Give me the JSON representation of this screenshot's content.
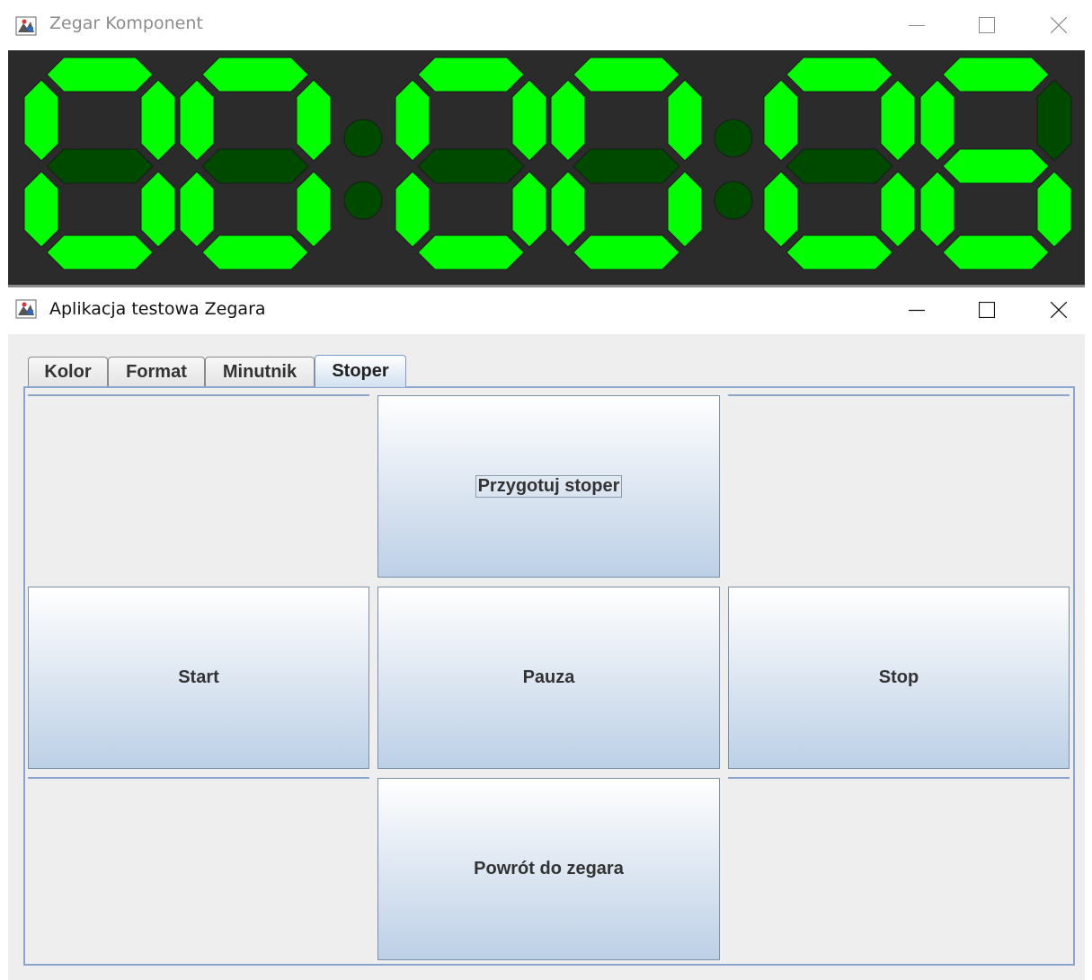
{
  "clock_window": {
    "title": "Zegar Komponent",
    "icons": [
      "java-app-icon",
      "minimize-icon",
      "maximize-icon",
      "close-icon"
    ],
    "display": {
      "background_color": "#2b2b2b",
      "segment_on_color": "#00ff00",
      "segment_off_color": "#004a00",
      "digits": [
        {
          "on": [
            "a",
            "b",
            "c",
            "d",
            "e",
            "f"
          ]
        },
        {
          "on": [
            "a",
            "b",
            "c",
            "d",
            "e",
            "f"
          ]
        },
        {
          "on": [
            "a",
            "b",
            "c",
            "d",
            "e",
            "f"
          ]
        },
        {
          "on": [
            "a",
            "b",
            "c",
            "d",
            "e",
            "f"
          ]
        },
        {
          "on": [
            "a",
            "b",
            "c",
            "d",
            "e",
            "f"
          ]
        },
        {
          "on": [
            "a",
            "c",
            "d",
            "e",
            "f",
            "g"
          ]
        }
      ],
      "colons_lit": false
    }
  },
  "test_window": {
    "title": "Aplikacja testowa Zegara",
    "tabs": [
      {
        "label": "Kolor",
        "selected": false
      },
      {
        "label": "Format",
        "selected": false
      },
      {
        "label": "Minutnik",
        "selected": false
      },
      {
        "label": "Stoper",
        "selected": true
      }
    ],
    "buttons": {
      "prepare": "Przygotuj stoper",
      "start": "Start",
      "pause": "Pauza",
      "stop": "Stop",
      "back": "Powrót do zegara"
    },
    "accent_color": "#8aa6cf"
  }
}
